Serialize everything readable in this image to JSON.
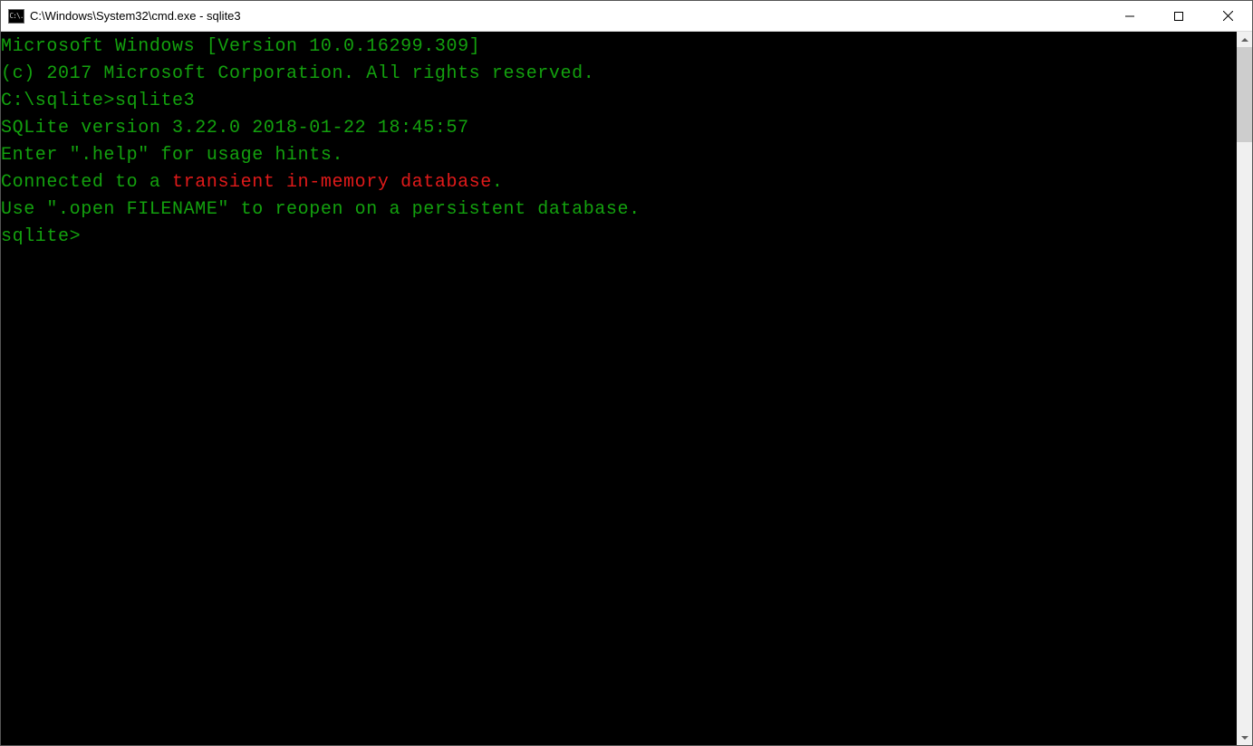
{
  "window": {
    "title": "C:\\Windows\\System32\\cmd.exe - sqlite3",
    "appIconText": "C:\\."
  },
  "terminal": {
    "line1": "Microsoft Windows [Version 10.0.16299.309]",
    "line2": "(c) 2017 Microsoft Corporation. All rights reserved.",
    "line3": "",
    "line4_prompt": "C:\\sqlite>",
    "line4_cmd": "sqlite3",
    "line5": "SQLite version 3.22.0 2018-01-22 18:45:57",
    "line6": "Enter \".help\" for usage hints.",
    "line7_prefix": "Connected to a ",
    "line7_red": "transient in-memory database",
    "line7_suffix": ".",
    "line8": "Use \".open FILENAME\" to reopen on a persistent database.",
    "line9": "sqlite>"
  }
}
